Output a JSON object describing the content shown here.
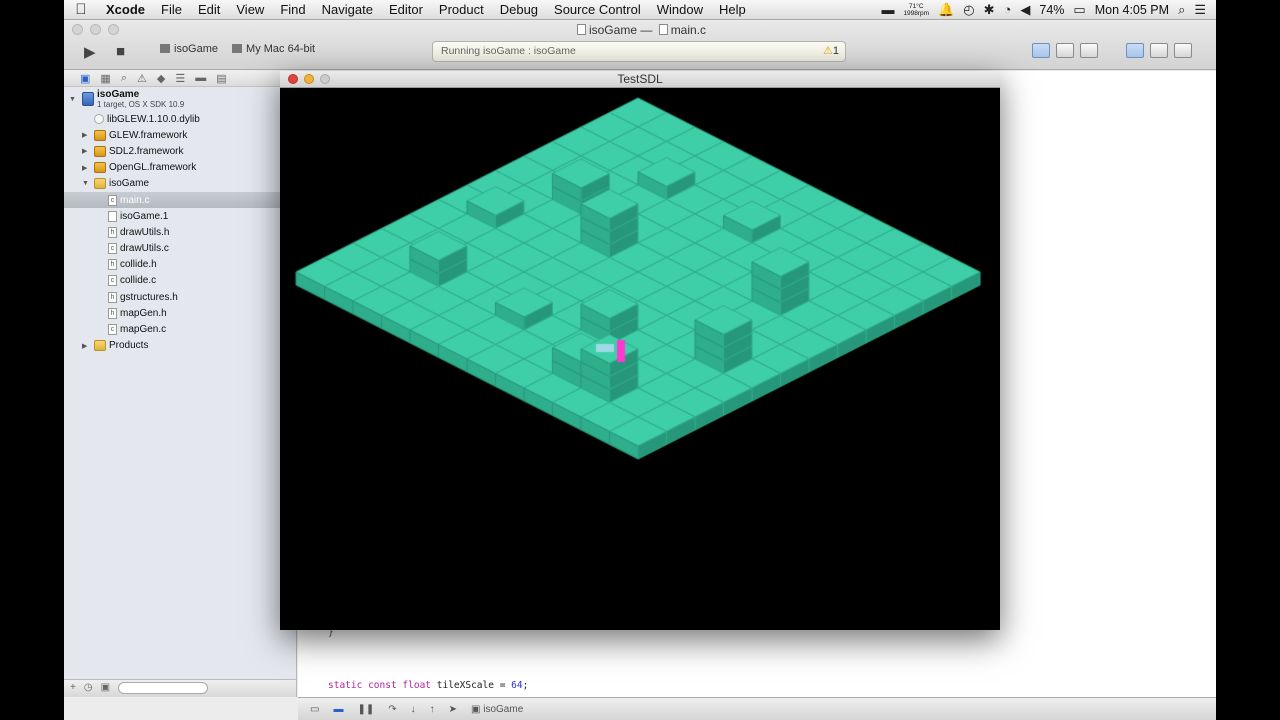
{
  "menubar": {
    "apple_icon": "apple-icon",
    "app_name": "Xcode",
    "items": [
      "File",
      "Edit",
      "View",
      "Find",
      "Navigate",
      "Editor",
      "Product",
      "Debug",
      "Source Control",
      "Window",
      "Help"
    ],
    "weather_temp": "71°C",
    "weather_rpm": "1998rpm",
    "battery": "74%",
    "clock": "Mon 4:05 PM"
  },
  "toolbar": {
    "title_project": "isoGame",
    "title_sep": "—",
    "title_file": "main.c",
    "scheme": "isoGame",
    "destination": "My Mac 64-bit",
    "activity": "Running isoGame : isoGame",
    "warning_count": "1"
  },
  "navigator": {
    "project": {
      "name": "isoGame",
      "subtitle": "1 target, OS X SDK 10.9"
    },
    "items": [
      {
        "label": "libGLEW.1.10.0.dylib",
        "kind": "lib",
        "indent": 1
      },
      {
        "label": "GLEW.framework",
        "kind": "fw",
        "indent": 1,
        "disclosure": "collapsed"
      },
      {
        "label": "SDL2.framework",
        "kind": "fw",
        "indent": 1,
        "disclosure": "collapsed"
      },
      {
        "label": "OpenGL.framework",
        "kind": "fw",
        "indent": 1,
        "disclosure": "collapsed"
      },
      {
        "label": "isoGame",
        "kind": "folder",
        "indent": 1,
        "disclosure": "expanded"
      },
      {
        "label": "main.c",
        "kind": "file",
        "indent": 2,
        "selected": true,
        "badge": "c"
      },
      {
        "label": "isoGame.1",
        "kind": "file",
        "indent": 2,
        "badge": ""
      },
      {
        "label": "drawUtils.h",
        "kind": "file",
        "indent": 2,
        "badge": "h"
      },
      {
        "label": "drawUtils.c",
        "kind": "file",
        "indent": 2,
        "badge": "c"
      },
      {
        "label": "collide.h",
        "kind": "file",
        "indent": 2,
        "badge": "h"
      },
      {
        "label": "collide.c",
        "kind": "file",
        "indent": 2,
        "badge": "c"
      },
      {
        "label": "gstructures.h",
        "kind": "file",
        "indent": 2,
        "badge": "h"
      },
      {
        "label": "mapGen.h",
        "kind": "file",
        "indent": 2,
        "badge": "h"
      },
      {
        "label": "mapGen.c",
        "kind": "file",
        "indent": 2,
        "badge": "c"
      },
      {
        "label": "Products",
        "kind": "folder",
        "indent": 1,
        "disclosure": "collapsed"
      }
    ]
  },
  "editor": {
    "code_line_brace": "}",
    "code_line": {
      "kw1": "static",
      "kw2": "const",
      "kw3": "float",
      "ident": "tileXScale",
      "op": "=",
      "num": "64",
      "end": ";"
    }
  },
  "debugbar": {
    "target": "isoGame"
  },
  "sdl": {
    "title": "TestSDL",
    "colors": {
      "top": "#3fcfa8",
      "left": "#2fae8c",
      "right": "#27977a",
      "background": "#000000",
      "player": "#ff38d0"
    }
  }
}
